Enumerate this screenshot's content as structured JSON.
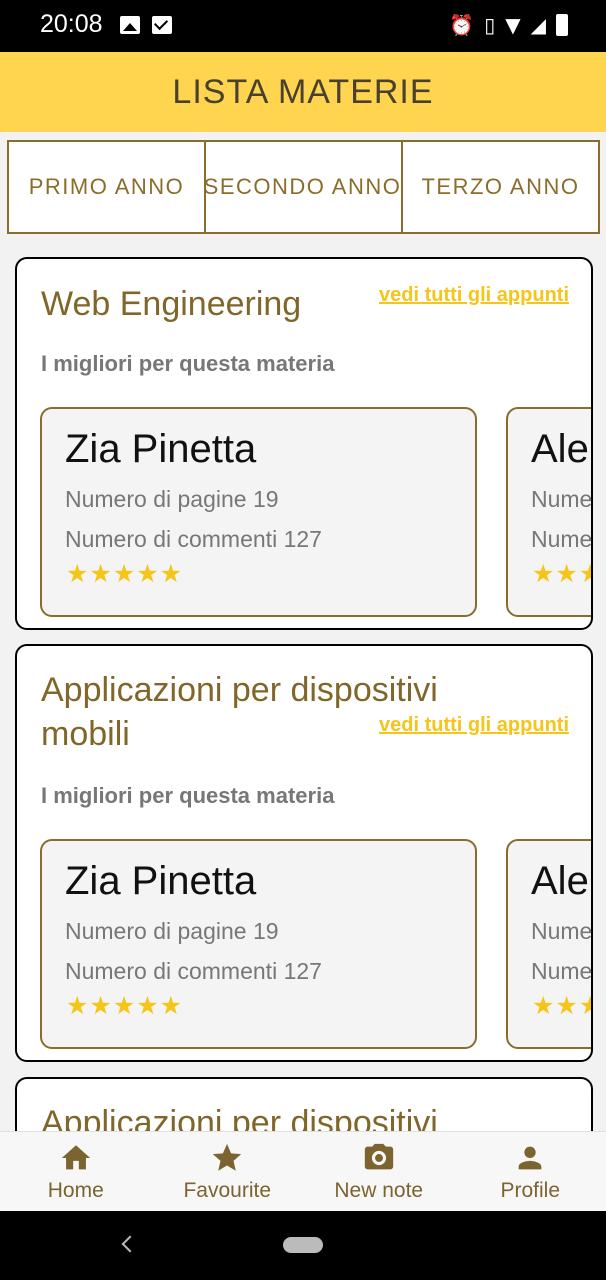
{
  "status_bar": {
    "time": "20:08"
  },
  "app_bar": {
    "title": "LISTA MATERIE"
  },
  "tabs": [
    {
      "label": "PRIMO ANNO"
    },
    {
      "label": "SECONDO ANNO"
    },
    {
      "label": "TERZO ANNO"
    }
  ],
  "courses": [
    {
      "title": "Web Engineering",
      "see_all": "vedi tutti gli appunti",
      "subtitle": "I migliori per questa materia",
      "notes": [
        {
          "author": "Zia Pinetta",
          "pages": "Numero di pagine 19",
          "comments": "Numero di commenti 127",
          "stars": "★★★★★"
        },
        {
          "author": "Ale",
          "pages": "Nume",
          "comments": "Nume",
          "stars": "★★★"
        }
      ]
    },
    {
      "title": "Applicazioni per dispositivi mobili",
      "see_all": "vedi tutti gli appunti",
      "subtitle": "I migliori per questa materia",
      "notes": [
        {
          "author": "Zia Pinetta",
          "pages": "Numero di pagine 19",
          "comments": "Numero di commenti 127",
          "stars": "★★★★★"
        },
        {
          "author": "Ale",
          "pages": "Nume",
          "comments": "Nume",
          "stars": "★★★"
        }
      ]
    },
    {
      "title": "Applicazioni per dispositivi"
    }
  ],
  "bottom_nav": [
    {
      "label": "Home",
      "icon": "home-icon"
    },
    {
      "label": "Favourite",
      "icon": "star-icon"
    },
    {
      "label": "New note",
      "icon": "camera-icon"
    },
    {
      "label": "Profile",
      "icon": "person-icon"
    }
  ],
  "colors": {
    "app_bar": "#ffd54f",
    "accent_brown": "#806628",
    "link_yellow": "#f5c518",
    "star": "#f5c518"
  }
}
